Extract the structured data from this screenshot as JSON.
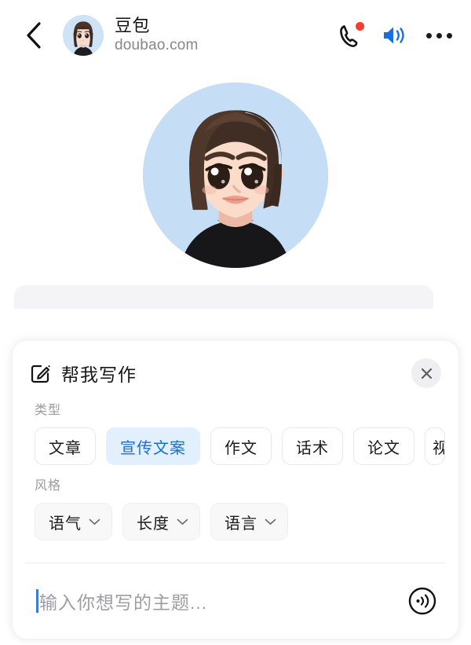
{
  "header": {
    "back_icon": "chevron-left-icon",
    "title": "豆包",
    "subtitle": "doubao.com",
    "avatar_label": "doubao-avatar",
    "actions": {
      "call_icon": "phone-icon",
      "call_badge": "notification-dot",
      "speaker_icon": "speaker-on-icon",
      "more_icon": "more-horizontal-icon"
    },
    "accent_blue": "#1a73e8",
    "badge_red": "#fa3b2f"
  },
  "conversation": {
    "avatar_label": "assistant-large-avatar",
    "avatar_bg": "#c5ddf5",
    "bubble_label": "message-bubble-partial",
    "bubble_bg": "#f4f4f6"
  },
  "panel": {
    "icon": "compose-icon",
    "title": "帮我写作",
    "close_icon": "close-icon",
    "type_section": {
      "label": "类型",
      "chips": [
        {
          "label": "文章",
          "selected": false
        },
        {
          "label": "宣传文案",
          "selected": true
        },
        {
          "label": "作文",
          "selected": false
        },
        {
          "label": "话术",
          "selected": false
        },
        {
          "label": "论文",
          "selected": false
        },
        {
          "label": "视",
          "selected": false,
          "clipped": true
        }
      ],
      "selected_bg": "#e2effc",
      "selected_text": "#1a6fd4"
    },
    "style_section": {
      "label": "风格",
      "chips": [
        {
          "label": "语气",
          "icon": "chevron-down-icon"
        },
        {
          "label": "长度",
          "icon": "chevron-down-icon"
        },
        {
          "label": "语言",
          "icon": "chevron-down-icon"
        }
      ]
    },
    "input": {
      "value": "",
      "placeholder": "输入你想写的主题...",
      "caret_color": "#3c7ae4",
      "voice_icon": "voice-input-icon"
    }
  }
}
